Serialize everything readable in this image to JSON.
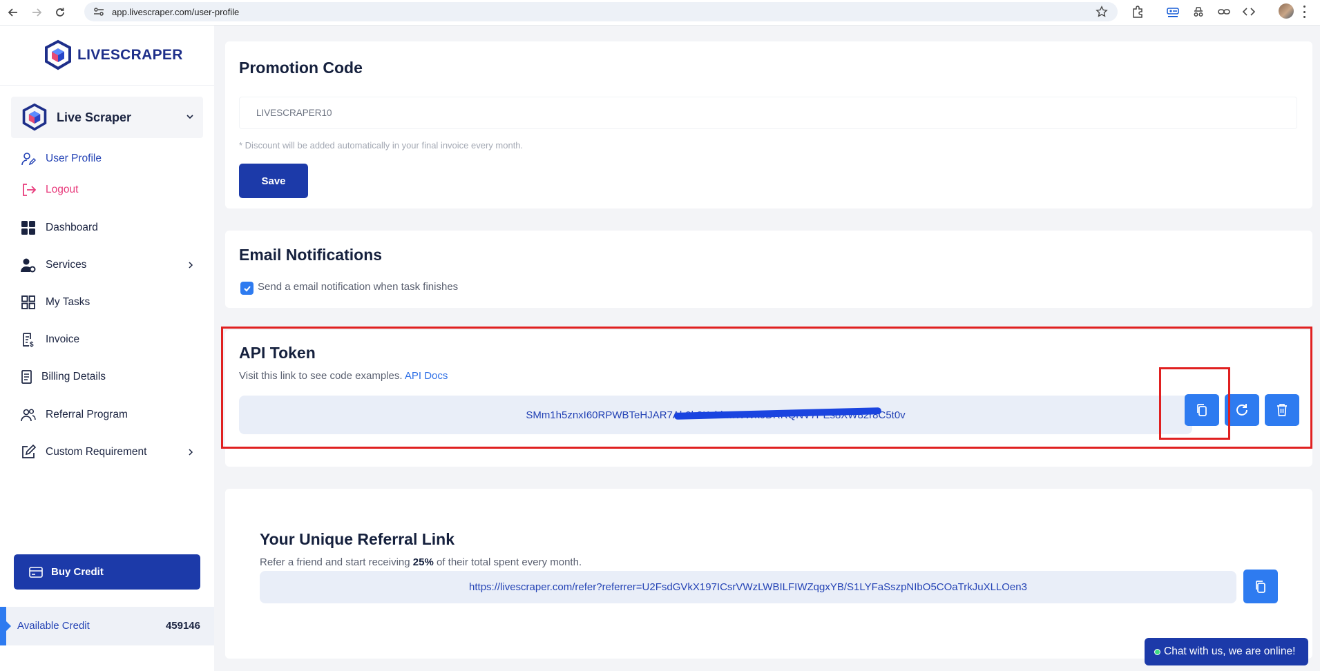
{
  "browser": {
    "url": "app.livescraper.com/user-profile"
  },
  "sidebar": {
    "logo_text": "LIVESCRAPER",
    "account_name": "Live Scraper",
    "menu": [
      {
        "label": "User Profile",
        "icon": "user-edit-icon",
        "active": true
      },
      {
        "label": "Logout",
        "icon": "logout-icon"
      },
      {
        "label": "Dashboard",
        "icon": "grid-icon"
      },
      {
        "label": "Services",
        "icon": "user-gear-icon",
        "has_children": true
      },
      {
        "label": "My Tasks",
        "icon": "tasks-icon"
      },
      {
        "label": "Invoice",
        "icon": "invoice-icon"
      },
      {
        "label": "Billing Details",
        "icon": "receipt-icon"
      },
      {
        "label": "Referral Program",
        "icon": "users-icon"
      },
      {
        "label": "Custom Requirement",
        "icon": "edit-icon",
        "has_children": true
      }
    ],
    "buy_credit_label": "Buy Credit",
    "available_credit_label": "Available Credit",
    "available_credit_value": "459146"
  },
  "promotion": {
    "title": "Promotion Code",
    "code_value": "LIVESCRAPER10",
    "hint": "* Discount will be added automatically in your final invoice every month.",
    "save_label": "Save"
  },
  "email": {
    "title": "Email Notifications",
    "checkbox_label": "Send a email notification when task finishes",
    "checked": true
  },
  "api": {
    "title": "API Token",
    "subtitle": "Visit this link to see code examples.",
    "docs_link": "API Docs",
    "token": "SMm1h5znxI60RPWBTeHJAR7Ah9b8KxhbmWWkoDRRQNV7PEs8XW82r8C5t0v"
  },
  "referral": {
    "title": "Your Unique Referral Link",
    "subtitle_before": "Refer a friend and start receiving",
    "subtitle_percent": "25%",
    "subtitle_after": "of their total spent every month.",
    "link": "https://livescraper.com/refer?referrer=U2FsdGVkX197ICsrVWzLWBILFIWZqgxYB/S1LYFaSszpNIbO5COaTrkJuXLLOen3"
  },
  "chat": {
    "label": "Chat with us, we are online!"
  },
  "colors": {
    "primary": "#1c3aa9",
    "accent": "#2e7bf0",
    "logout": "#e83a7b",
    "highlight_outline": "#e02020"
  }
}
